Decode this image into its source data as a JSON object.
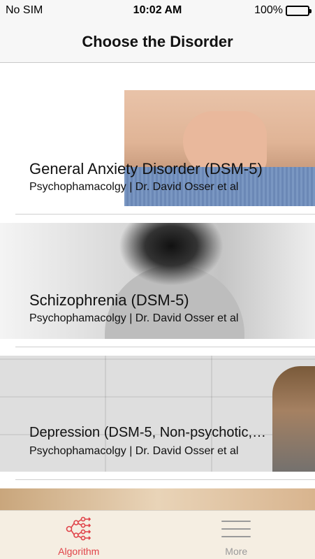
{
  "status_bar": {
    "carrier": "No SIM",
    "time": "10:02 AM",
    "battery": "100%"
  },
  "nav": {
    "title": "Choose the Disorder"
  },
  "disorders": [
    {
      "title": "General Anxiety Disorder (DSM-5)",
      "subtitle": "Psychophamacolgy | Dr. David Osser et al"
    },
    {
      "title": "Schizophrenia (DSM-5)",
      "subtitle": "Psychophamacolgy | Dr. David Osser et al"
    },
    {
      "title": "Depression (DSM-5, Non-psychotic,…",
      "subtitle": "Psychophamacolgy | Dr. David Osser et al"
    }
  ],
  "tabs": [
    {
      "label": "Algorithm",
      "icon": "algorithm-icon",
      "active": true
    },
    {
      "label": "More",
      "icon": "menu-icon",
      "active": false
    }
  ],
  "colors": {
    "accent": "#e0444a",
    "inactive": "#9a9a9a",
    "tab_bar_bg": "#f5eee2"
  }
}
